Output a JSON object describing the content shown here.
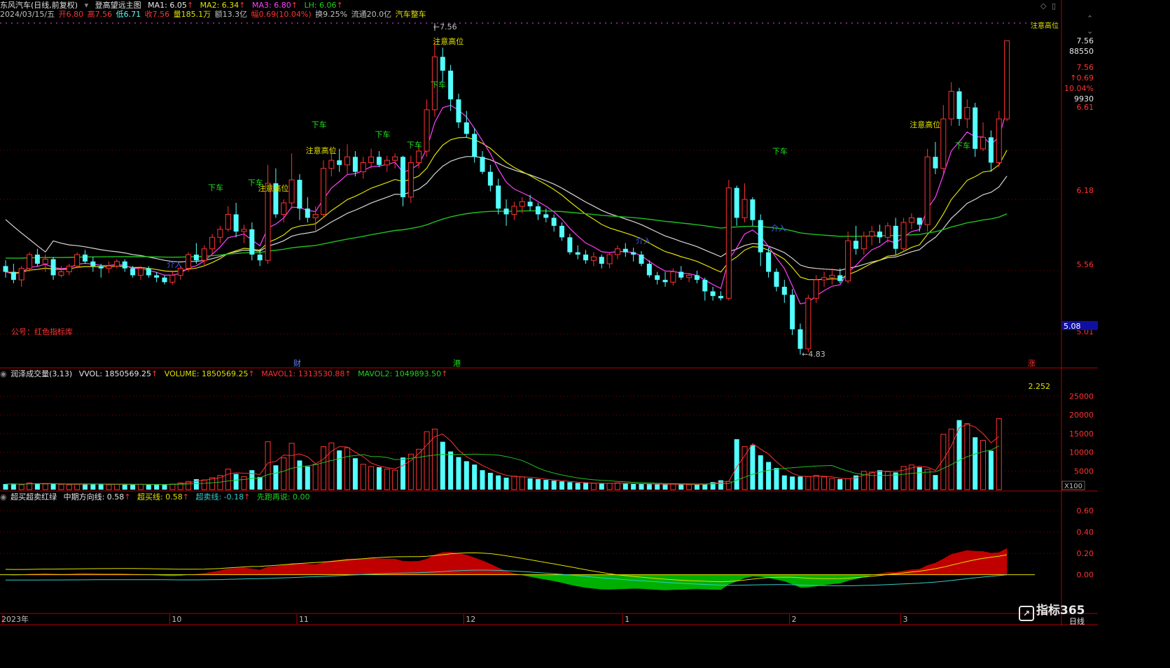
{
  "header": {
    "stock_name": "东风汽车(日线,前复权)",
    "indicator_name": "登高望远主图",
    "ma1": "MA1: 6.05",
    "ma2": "MA2: 6.34",
    "ma3": "MA3: 6.80",
    "lh": "LH: 6.06",
    "arrow": "↑",
    "date": "2024/03/15/五",
    "open": "开6.80",
    "high": "高7.56",
    "low": "低6.71",
    "close": "收7.56",
    "vol": "量185.1万",
    "amount": "额13.3亿",
    "change": "幅0.69(10.04%)",
    "turnover": "换9.25%",
    "float": "流通20.0亿",
    "sector": "汽车整车"
  },
  "main_axis": {
    "ticks": [
      {
        "label": "7.56",
        "value": 7.56
      },
      {
        "label": "88550",
        "value": 7.4
      },
      {
        "label": "7.56",
        "value": 7.17
      },
      {
        "label": "↑0.69",
        "value": 7.02
      },
      {
        "label": "10.04%",
        "value": 6.88
      },
      {
        "label": "9930",
        "value": 6.74
      },
      {
        "label": "6.61",
        "value": 6.61
      },
      {
        "label": "6.18",
        "value": 6.18
      },
      {
        "label": "5.56",
        "value": 5.56
      },
      {
        "label": "5.01",
        "value": 5.01
      }
    ],
    "current_price_label": "5.08",
    "current_price": 5.08,
    "ylim": [
      4.72,
      7.72
    ]
  },
  "main_annotations": {
    "watermark": "公号：红色指标库",
    "high_marker": "←7.56",
    "low_marker": "←4.83",
    "caution_label": "注意高位",
    "sell_label": "下车",
    "buy_label": "介入",
    "event_cai": "财",
    "event_gang": "港",
    "event_zhang": "涨",
    "caution_tag_right": "注意高位"
  },
  "vol_header": {
    "name": "润泽成交量(3,13)",
    "vvol": "VVOL: 1850569.25",
    "volume": "VOLUME: 1850569.25",
    "mavol1": "MAVOL1: 1313530.88",
    "mavol2": "MAVOL2: 1049893.50",
    "arrow": "↑"
  },
  "vol_axis": {
    "ticks": [
      {
        "label": "25000",
        "value": 25000
      },
      {
        "label": "20000",
        "value": 20000
      },
      {
        "label": "15000",
        "value": 15000
      },
      {
        "label": "10000",
        "value": 10000
      },
      {
        "label": "5000",
        "value": 5000
      }
    ],
    "unit": "X100",
    "ratio": "2.252",
    "ylim": [
      0,
      29000
    ]
  },
  "osc_header": {
    "name": "超买超卖红绿",
    "mid": "中期方向线: 0.58",
    "overbuy": "超买线: 0.58",
    "oversell": "超卖线: -0.18",
    "first": "先跑再说: 0.00",
    "arrow": "↑"
  },
  "osc_axis": {
    "ticks": [
      {
        "label": "0.60",
        "value": 0.6
      },
      {
        "label": "0.40",
        "value": 0.4
      },
      {
        "label": "0.20",
        "value": 0.2
      },
      {
        "label": "0.00",
        "value": 0.0
      }
    ],
    "ylim": [
      -0.35,
      0.68
    ]
  },
  "time_axis": {
    "labels": [
      {
        "label": "2023年",
        "index": 0
      },
      {
        "label": "10",
        "index": 21
      },
      {
        "label": "11",
        "index": 37
      },
      {
        "label": "12",
        "index": 58
      },
      {
        "label": "1",
        "index": 78
      },
      {
        "label": "2",
        "index": 99
      },
      {
        "label": "3",
        "index": 113
      }
    ]
  },
  "footer": {
    "period": "日线",
    "logo_text": "指标365"
  },
  "colors": {
    "up": "#ff3232",
    "down": "#54ffff",
    "ma_white": "#d8d8d8",
    "ma_yellow": "#e0e000",
    "ma_magenta": "#ff40ff",
    "ma_green": "#20c020",
    "grid": "#8b0000",
    "fill_red": "#c00000",
    "fill_green": "#00b000",
    "cyan_line": "#33cccc"
  },
  "chart_data": {
    "type": "candlestick",
    "candles": [
      [
        5.6,
        5.65,
        5.5,
        5.55
      ],
      [
        5.55,
        5.62,
        5.45,
        5.48
      ],
      [
        5.48,
        5.6,
        5.42,
        5.58
      ],
      [
        5.58,
        5.72,
        5.55,
        5.7
      ],
      [
        5.7,
        5.75,
        5.6,
        5.62
      ],
      [
        5.62,
        5.7,
        5.55,
        5.66
      ],
      [
        5.66,
        5.68,
        5.48,
        5.52
      ],
      [
        5.52,
        5.6,
        5.5,
        5.55
      ],
      [
        5.55,
        5.62,
        5.52,
        5.6
      ],
      [
        5.6,
        5.72,
        5.58,
        5.7
      ],
      [
        5.7,
        5.74,
        5.62,
        5.64
      ],
      [
        5.64,
        5.68,
        5.55,
        5.6
      ],
      [
        5.6,
        5.62,
        5.5,
        5.58
      ],
      [
        5.58,
        5.64,
        5.54,
        5.6
      ],
      [
        5.6,
        5.66,
        5.58,
        5.64
      ],
      [
        5.64,
        5.66,
        5.55,
        5.58
      ],
      [
        5.58,
        5.6,
        5.5,
        5.52
      ],
      [
        5.52,
        5.6,
        5.48,
        5.58
      ],
      [
        5.58,
        5.6,
        5.5,
        5.52
      ],
      [
        5.52,
        5.55,
        5.46,
        5.5
      ],
      [
        5.5,
        5.52,
        5.44,
        5.46
      ],
      [
        5.46,
        5.55,
        5.44,
        5.52
      ],
      [
        5.52,
        5.6,
        5.48,
        5.58
      ],
      [
        5.58,
        5.72,
        5.55,
        5.7
      ],
      [
        5.7,
        5.8,
        5.62,
        5.65
      ],
      [
        5.65,
        5.78,
        5.6,
        5.75
      ],
      [
        5.75,
        5.88,
        5.7,
        5.85
      ],
      [
        5.85,
        5.95,
        5.8,
        5.92
      ],
      [
        5.92,
        6.12,
        5.9,
        6.05
      ],
      [
        6.05,
        6.15,
        5.85,
        5.9
      ],
      [
        5.9,
        5.96,
        5.8,
        5.92
      ],
      [
        5.92,
        5.98,
        5.65,
        5.7
      ],
      [
        5.7,
        5.75,
        5.6,
        5.65
      ],
      [
        5.65,
        6.48,
        5.62,
        6.32
      ],
      [
        6.32,
        6.45,
        6.02,
        6.05
      ],
      [
        6.05,
        6.18,
        5.98,
        6.15
      ],
      [
        6.15,
        6.58,
        6.1,
        6.35
      ],
      [
        6.35,
        6.4,
        6.0,
        6.1
      ],
      [
        6.1,
        6.2,
        5.98,
        6.02
      ],
      [
        6.02,
        6.12,
        5.9,
        6.05
      ],
      [
        6.05,
        6.52,
        6.02,
        6.45
      ],
      [
        6.45,
        6.62,
        6.38,
        6.52
      ],
      [
        6.52,
        6.62,
        6.42,
        6.48
      ],
      [
        6.48,
        6.66,
        6.4,
        6.55
      ],
      [
        6.55,
        6.6,
        6.38,
        6.42
      ],
      [
        6.42,
        6.55,
        6.36,
        6.5
      ],
      [
        6.5,
        6.62,
        6.45,
        6.55
      ],
      [
        6.55,
        6.6,
        6.46,
        6.48
      ],
      [
        6.48,
        6.56,
        6.42,
        6.52
      ],
      [
        6.52,
        6.58,
        6.45,
        6.55
      ],
      [
        6.55,
        6.56,
        6.12,
        6.2
      ],
      [
        6.2,
        6.56,
        6.15,
        6.5
      ],
      [
        6.5,
        6.66,
        6.45,
        6.6
      ],
      [
        6.6,
        7.05,
        6.55,
        6.96
      ],
      [
        6.96,
        7.56,
        6.9,
        7.42
      ],
      [
        7.42,
        7.5,
        7.2,
        7.3
      ],
      [
        7.3,
        7.35,
        6.95,
        7.05
      ],
      [
        7.05,
        7.1,
        6.8,
        6.85
      ],
      [
        6.85,
        6.95,
        6.72,
        6.75
      ],
      [
        6.75,
        6.8,
        6.5,
        6.55
      ],
      [
        6.55,
        6.6,
        6.4,
        6.42
      ],
      [
        6.42,
        6.48,
        6.25,
        6.3
      ],
      [
        6.3,
        6.36,
        6.05,
        6.1
      ],
      [
        6.1,
        6.18,
        5.95,
        6.05
      ],
      [
        6.05,
        6.16,
        6.0,
        6.12
      ],
      [
        6.12,
        6.2,
        6.06,
        6.16
      ],
      [
        6.16,
        6.22,
        6.08,
        6.12
      ],
      [
        6.12,
        6.15,
        6.0,
        6.05
      ],
      [
        6.05,
        6.1,
        5.98,
        6.02
      ],
      [
        6.02,
        6.05,
        5.9,
        5.95
      ],
      [
        5.95,
        5.98,
        5.82,
        5.85
      ],
      [
        5.85,
        5.88,
        5.7,
        5.72
      ],
      [
        5.72,
        5.78,
        5.66,
        5.7
      ],
      [
        5.7,
        5.74,
        5.62,
        5.65
      ],
      [
        5.65,
        5.72,
        5.6,
        5.68
      ],
      [
        5.68,
        5.7,
        5.58,
        5.62
      ],
      [
        5.62,
        5.72,
        5.58,
        5.7
      ],
      [
        5.7,
        5.78,
        5.66,
        5.75
      ],
      [
        5.75,
        5.8,
        5.68,
        5.72
      ],
      [
        5.72,
        5.76,
        5.64,
        5.7
      ],
      [
        5.7,
        5.73,
        5.6,
        5.62
      ],
      [
        5.62,
        5.65,
        5.5,
        5.52
      ],
      [
        5.52,
        5.55,
        5.44,
        5.48
      ],
      [
        5.48,
        5.55,
        5.42,
        5.46
      ],
      [
        5.46,
        5.58,
        5.43,
        5.55
      ],
      [
        5.55,
        5.6,
        5.48,
        5.5
      ],
      [
        5.5,
        5.54,
        5.46,
        5.52
      ],
      [
        5.52,
        5.56,
        5.45,
        5.48
      ],
      [
        5.48,
        5.5,
        5.3,
        5.38
      ],
      [
        5.38,
        5.42,
        5.3,
        5.34
      ],
      [
        5.34,
        5.38,
        5.3,
        5.32
      ],
      [
        5.32,
        6.35,
        5.3,
        6.28
      ],
      [
        6.28,
        6.3,
        5.95,
        6.02
      ],
      [
        6.02,
        6.32,
        5.98,
        6.18
      ],
      [
        6.18,
        6.2,
        5.95,
        6.0
      ],
      [
        6.0,
        6.05,
        5.6,
        5.72
      ],
      [
        5.72,
        5.76,
        5.5,
        5.55
      ],
      [
        5.55,
        5.58,
        5.38,
        5.42
      ],
      [
        5.42,
        5.48,
        5.28,
        5.35
      ],
      [
        5.35,
        5.4,
        5.0,
        5.05
      ],
      [
        5.05,
        5.1,
        4.83,
        4.88
      ],
      [
        4.88,
        5.35,
        4.85,
        5.32
      ],
      [
        5.32,
        5.52,
        5.28,
        5.48
      ],
      [
        5.48,
        5.55,
        5.42,
        5.5
      ],
      [
        5.5,
        5.58,
        5.44,
        5.52
      ],
      [
        5.52,
        5.58,
        5.45,
        5.47
      ],
      [
        5.47,
        5.9,
        5.45,
        5.82
      ],
      [
        5.82,
        5.95,
        5.7,
        5.75
      ],
      [
        5.75,
        5.9,
        5.7,
        5.86
      ],
      [
        5.86,
        5.95,
        5.78,
        5.9
      ],
      [
        5.9,
        5.96,
        5.8,
        5.85
      ],
      [
        5.85,
        5.98,
        5.8,
        5.95
      ],
      [
        5.95,
        6.02,
        5.7,
        5.75
      ],
      [
        5.75,
        6.02,
        5.72,
        5.98
      ],
      [
        5.98,
        6.06,
        5.92,
        6.02
      ],
      [
        6.02,
        6.02,
        5.9,
        5.96
      ],
      [
        5.96,
        6.62,
        5.9,
        6.55
      ],
      [
        6.55,
        6.68,
        6.4,
        6.45
      ],
      [
        6.45,
        7.0,
        6.4,
        6.88
      ],
      [
        6.88,
        7.2,
        6.82,
        7.12
      ],
      [
        7.12,
        7.15,
        6.82,
        6.88
      ],
      [
        6.88,
        7.05,
        6.8,
        6.98
      ],
      [
        6.98,
        7.02,
        6.55,
        6.62
      ],
      [
        6.62,
        6.85,
        6.6,
        6.72
      ],
      [
        6.72,
        6.78,
        6.42,
        6.5
      ],
      [
        6.5,
        6.95,
        6.46,
        6.88
      ],
      [
        6.88,
        7.56,
        6.86,
        7.56
      ]
    ],
    "vol": [
      1500,
      1600,
      1300,
      1800,
      1700,
      1500,
      1600,
      1400,
      1300,
      1500,
      1600,
      1400,
      1500,
      1300,
      1400,
      1500,
      1300,
      1400,
      1400,
      1300,
      1400,
      1500,
      1800,
      2200,
      2800,
      2600,
      3200,
      3800,
      5500,
      4200,
      3500,
      5200,
      3400,
      12800,
      6500,
      8500,
      12400,
      7800,
      6200,
      6800,
      11500,
      12500,
      10500,
      11200,
      8400,
      6800,
      6200,
      6000,
      5500,
      5200,
      8600,
      9500,
      10800,
      15500,
      16200,
      12800,
      10200,
      8700,
      7600,
      6700,
      5200,
      4500,
      3800,
      3200,
      3600,
      3400,
      3000,
      2800,
      2600,
      2400,
      2200,
      2000,
      1800,
      1800,
      1700,
      1600,
      1700,
      1800,
      1600,
      1500,
      1600,
      1500,
      1400,
      1400,
      1500,
      1400,
      1300,
      1400,
      1500,
      2000,
      2500,
      2200,
      13500,
      11500,
      11900,
      9200,
      7400,
      5800,
      3800,
      3500,
      3500,
      3500,
      3800,
      3400,
      3000,
      2800,
      2900,
      3800,
      4900,
      4700,
      5200,
      4800,
      4600,
      6200,
      6600,
      6000,
      5400,
      3900,
      14800,
      16200,
      18600,
      17700,
      14000,
      13200,
      10400,
      19000
    ]
  }
}
